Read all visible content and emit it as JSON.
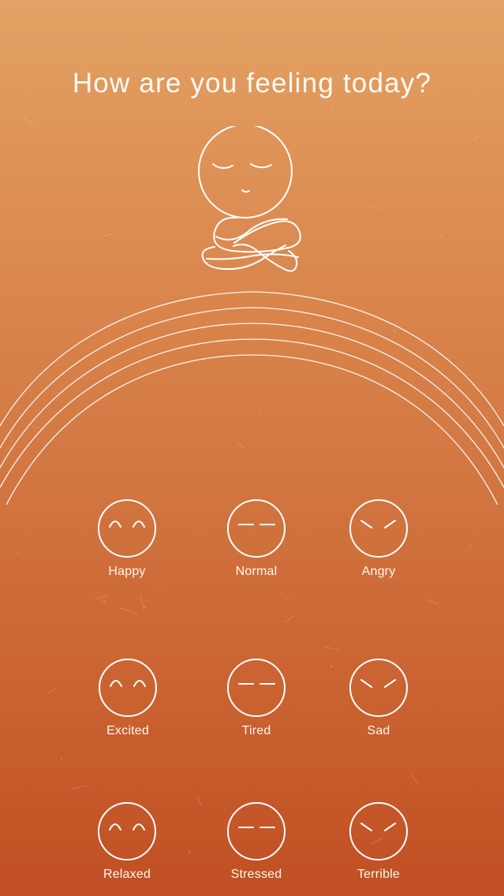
{
  "header": {
    "title": "How are you feeling today?"
  },
  "colors": {
    "background_top": "#e3a265",
    "background_bottom": "#c04f23",
    "line": "#ffffff"
  },
  "illustration": {
    "icon": "meditating-person-icon"
  },
  "moods": [
    {
      "label": "Happy",
      "face": "smiling-eyes"
    },
    {
      "label": "Normal",
      "face": "flat-eyes"
    },
    {
      "label": "Angry",
      "face": "angled-eyes"
    },
    {
      "label": "Excited",
      "face": "smiling-eyes"
    },
    {
      "label": "Tired",
      "face": "flat-eyes"
    },
    {
      "label": "Sad",
      "face": "angled-eyes"
    },
    {
      "label": "Relaxed",
      "face": "smiling-eyes"
    },
    {
      "label": "Stressed",
      "face": "flat-eyes"
    },
    {
      "label": "Terrible",
      "face": "angled-eyes"
    }
  ]
}
